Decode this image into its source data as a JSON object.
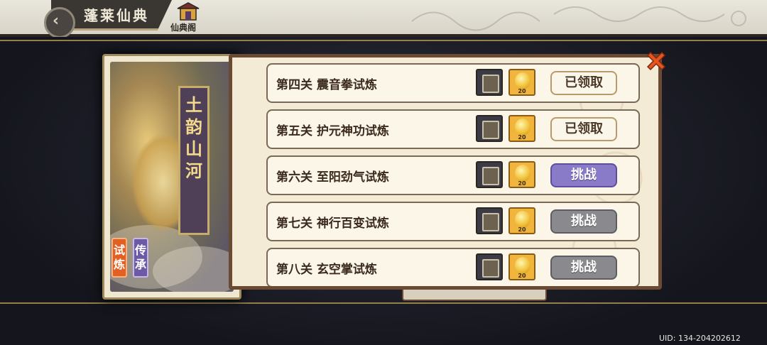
{
  "header": {
    "title": "蓬莱仙典",
    "back_icon": "back-arrow-icon",
    "tab_label": "仙典阁"
  },
  "book": {
    "title_chars": [
      "土",
      "韵",
      "山",
      "河"
    ],
    "tabs": [
      {
        "label_chars": [
          "试",
          "炼"
        ],
        "active": true
      },
      {
        "label_chars": [
          "传",
          "承"
        ],
        "active": false
      }
    ]
  },
  "stages": [
    {
      "name": "第四关 震音拳试炼",
      "reward_qty": "20",
      "button": "已领取",
      "state": "claimed"
    },
    {
      "name": "第五关 护元神功试炼",
      "reward_qty": "20",
      "button": "已领取",
      "state": "claimed"
    },
    {
      "name": "第六关 至阳劲气试炼",
      "reward_qty": "20",
      "button": "挑战",
      "state": "available"
    },
    {
      "name": "第七关 神行百变试炼",
      "reward_qty": "20",
      "button": "挑战",
      "state": "locked"
    },
    {
      "name": "第八关 玄空掌试炼",
      "reward_qty": "20",
      "button": "挑战",
      "state": "locked"
    }
  ],
  "footer": {
    "uid": "UID: 134-204202612"
  },
  "colors": {
    "challenge_available": "#8a7bc8",
    "challenge_locked": "#8a8a8e",
    "active_tab": "#e36024",
    "inactive_tab": "#6c5aa6",
    "close_icon": "#e8541e"
  }
}
